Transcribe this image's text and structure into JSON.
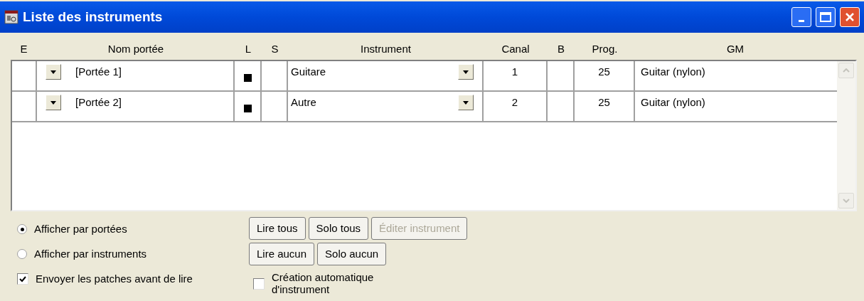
{
  "window": {
    "title": "Liste des instruments"
  },
  "table": {
    "columns": [
      "E",
      "Nom portée",
      "L",
      "S",
      "Instrument",
      "Canal",
      "B",
      "Prog.",
      "GM"
    ],
    "rows": [
      {
        "staff": "[Portée 1]",
        "play": true,
        "solo": false,
        "instrument": "Guitare",
        "channel": "1",
        "program": "25",
        "gm": "Guitar (nylon)"
      },
      {
        "staff": "[Portée 2]",
        "play": true,
        "solo": false,
        "instrument": "Autre",
        "channel": "2",
        "program": "25",
        "gm": "Guitar (nylon)"
      }
    ]
  },
  "view_options": [
    {
      "label": "Afficher par portées",
      "selected": true
    },
    {
      "label": "Afficher par instruments",
      "selected": false
    }
  ],
  "send_patches": {
    "label": "Envoyer les patches avant de lire",
    "checked": true
  },
  "buttons": [
    {
      "label": "Lire tous",
      "disabled": false
    },
    {
      "label": "Solo tous",
      "disabled": false
    },
    {
      "label": "Éditer instrument",
      "disabled": true
    },
    {
      "label": "Lire aucun",
      "disabled": false
    },
    {
      "label": "Solo aucun",
      "disabled": false
    }
  ],
  "auto_create": {
    "label": "Création automatique d'instrument",
    "checked": false
  }
}
